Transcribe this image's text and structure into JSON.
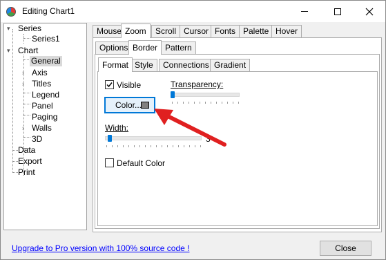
{
  "window": {
    "title": "Editing Chart1"
  },
  "tree": {
    "items": [
      {
        "label": "Series",
        "toggle": "▾"
      },
      {
        "label": "Series1"
      },
      {
        "label": "Chart",
        "toggle": "▾"
      },
      {
        "label": "General",
        "selected": true
      },
      {
        "label": "Axis",
        "toggle": "›"
      },
      {
        "label": "Titles",
        "toggle": "›"
      },
      {
        "label": "Legend"
      },
      {
        "label": "Panel"
      },
      {
        "label": "Paging"
      },
      {
        "label": "Walls",
        "toggle": "›"
      },
      {
        "label": "3D"
      },
      {
        "label": "Data"
      },
      {
        "label": "Export"
      },
      {
        "label": "Print"
      }
    ]
  },
  "tabs_top": [
    "Mouse",
    "Zoom",
    "Scroll",
    "Cursor",
    "Fonts",
    "Palette",
    "Hover"
  ],
  "tabs_top_active": "Zoom",
  "tabs_mid": [
    "Options",
    "Border",
    "Pattern"
  ],
  "tabs_mid_active": "Border",
  "tabs_inner": [
    "Format",
    "Style",
    "Connections",
    "Gradient"
  ],
  "tabs_inner_active": "Format",
  "format": {
    "visible_label": "Visible",
    "visible_checked": true,
    "color_button_label": "Color...",
    "color_swatch": "#808080",
    "transparency_label": "Transparency:",
    "transparency_value": 0,
    "width_label": "Width:",
    "width_value": "3",
    "default_color_label": "Default Color",
    "default_color_checked": false
  },
  "footer": {
    "upgrade_link": "Upgrade to Pro version with 100% source code !",
    "close_label": "Close"
  },
  "colors": {
    "accent": "#0078d7",
    "arrow": "#e02020",
    "link": "#0000ff"
  }
}
